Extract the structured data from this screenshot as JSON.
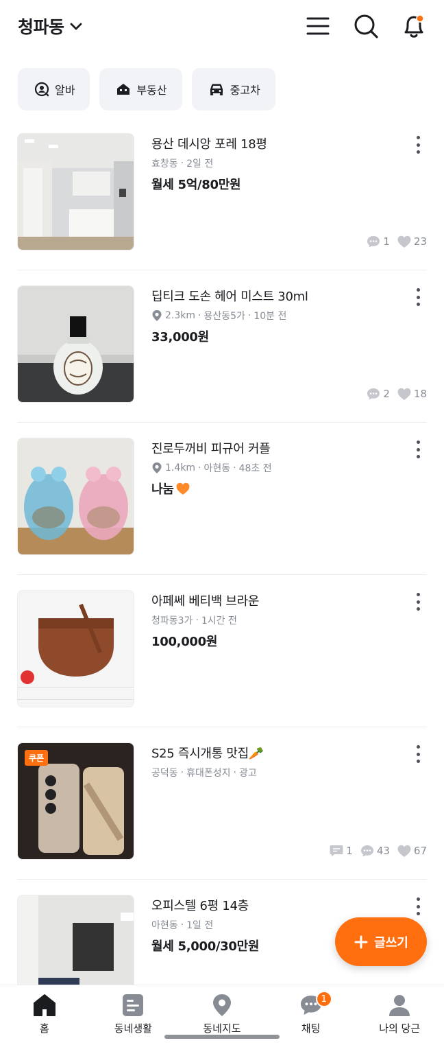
{
  "header": {
    "location": "청파동",
    "icons": [
      "menu-icon",
      "search-icon",
      "bell-icon"
    ],
    "notification_dot_color": "#ff6f0f"
  },
  "chips": [
    {
      "label": "알바",
      "icon": "person-search-icon"
    },
    {
      "label": "부동산",
      "icon": "house-icon"
    },
    {
      "label": "중고차",
      "icon": "car-icon"
    }
  ],
  "items": [
    {
      "title": "용산 데시앙 포레 18평",
      "meta_loc": "효창동",
      "meta_time": "2일 전",
      "price": "월세 5억/80만원",
      "comments": "1",
      "likes": "23"
    },
    {
      "title": "딥티크 도손 헤어 미스트 30ml",
      "distance": "2.3km",
      "meta_loc": "용산동5가",
      "meta_time": "10분 전",
      "price": "33,000원",
      "comments": "2",
      "likes": "18"
    },
    {
      "title": "진로두꺼비 피규어 커플",
      "distance": "1.4km",
      "meta_loc": "아현동",
      "meta_time": "48초 전",
      "price": "나눔"
    },
    {
      "title": "아페쎄 베티백 브라운",
      "meta_loc": "청파동3가",
      "meta_time": "1시간 전",
      "price": "100,000원"
    },
    {
      "title": "S25 즉시개통 맛집🥕",
      "meta_loc": "공덕동",
      "meta_shop": "휴대폰성지",
      "meta_time": "광고",
      "coupon": "쿠폰",
      "chats": "1",
      "comments": "43",
      "likes": "67"
    },
    {
      "title": "오피스텔 6평 14층",
      "meta_loc": "아현동",
      "meta_time": "1일 전",
      "price": "월세 5,000/30만원"
    }
  ],
  "fab": {
    "label": "글쓰기",
    "color": "#ff6f0f"
  },
  "nav": {
    "items": [
      {
        "label": "홈",
        "icon": "home-icon"
      },
      {
        "label": "동네생활",
        "icon": "post-icon"
      },
      {
        "label": "동네지도",
        "icon": "map-pin-icon"
      },
      {
        "label": "채팅",
        "icon": "chat-icon",
        "badge": "1"
      },
      {
        "label": "나의 당근",
        "icon": "person-icon"
      }
    ]
  }
}
